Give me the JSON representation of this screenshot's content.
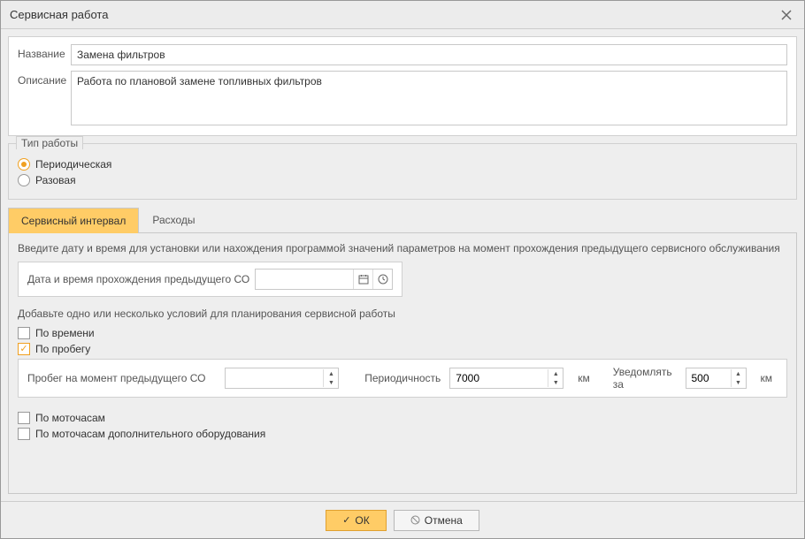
{
  "titlebar": {
    "title": "Сервисная работа"
  },
  "form": {
    "name_label": "Название",
    "name_value": "Замена фильтров",
    "desc_label": "Описание",
    "desc_value": "Работа по плановой замене топливных фильтров"
  },
  "work_type": {
    "legend": "Тип работы",
    "periodic": "Периодическая",
    "single": "Разовая"
  },
  "tabs": {
    "interval": "Сервисный интервал",
    "expenses": "Расходы"
  },
  "interval": {
    "hint1": "Введите дату и время для установки или нахождения программой значений параметров на момент прохождения предыдущего сервисного обслуживания",
    "dt_label": "Дата и время прохождения предыдущего СО",
    "dt_value": "",
    "hint2": "Добавьте одно или несколько условий для планирования сервисной работы",
    "by_time": "По времени",
    "by_mileage": "По пробегу",
    "mileage_prev_label": "Пробег на момент предыдущего СО",
    "mileage_prev_value": "",
    "periodicity_label": "Периодичность",
    "periodicity_value": "7000",
    "unit_km": "км",
    "notify_label": "Уведомлять за",
    "notify_value": "500",
    "by_hours": "По моточасам",
    "by_hours_extra": "По моточасам дополнительного оборудования"
  },
  "footer": {
    "ok": "ОК",
    "cancel": "Отмена"
  }
}
